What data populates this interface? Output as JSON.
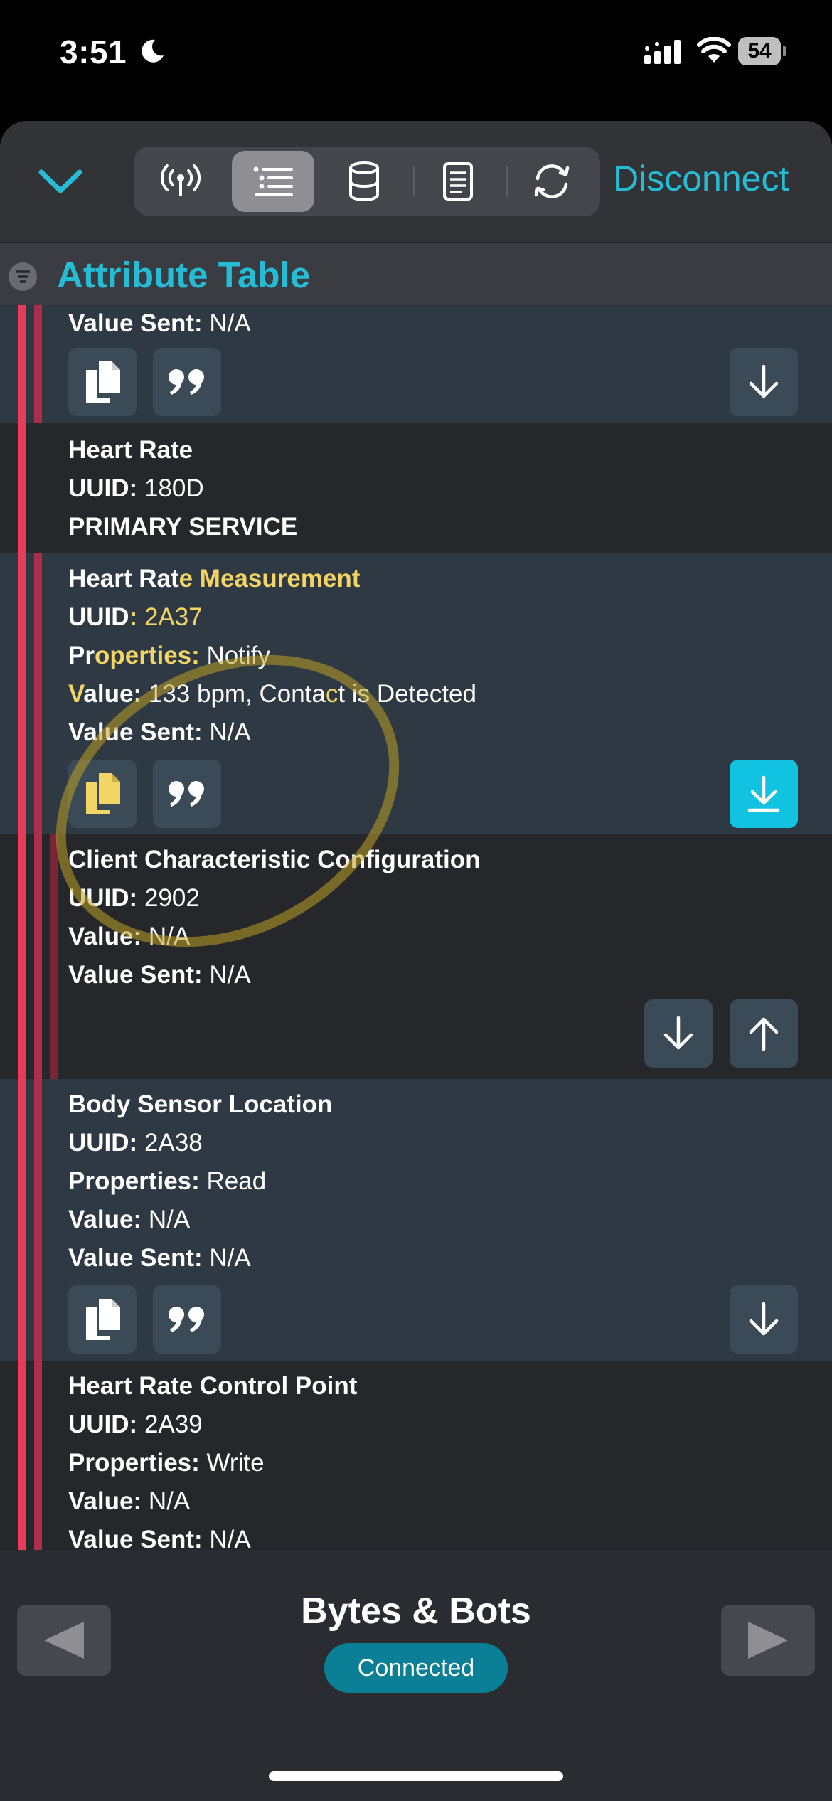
{
  "status": {
    "time": "3:51",
    "battery": "54"
  },
  "toolbar": {
    "tabs": [
      "antenna-icon",
      "list-icon",
      "database-icon",
      "document-icon",
      "sync-icon"
    ],
    "disconnect_label": "Disconnect"
  },
  "header": {
    "title": "Attribute Table"
  },
  "records": {
    "r0": {
      "value_sent_label": "Value Sent:",
      "value_sent": "N/A"
    },
    "r1": {
      "name": "Heart Rate",
      "uuid_label": "UUID:",
      "uuid": "180D",
      "type": "PRIMARY SERVICE"
    },
    "r2": {
      "name_a": "Heart Rat",
      "name_b": "e Measurement",
      "uuid_label_a": "UUID",
      "uuid_label_b": ":",
      "uuid": "2A37",
      "props_label_a": "Pr",
      "props_label_b": "operties:",
      "props_value": "Notify",
      "value_label_a": "V",
      "value_label_b": "alue:",
      "value_a": "133 bpm, Conta",
      "value_b": "c",
      "value_c": "t is Detected",
      "value_sent_label": "Value Sent:",
      "value_sent": "N/A"
    },
    "r3": {
      "name": "Client Characteristic Configuration",
      "uuid_label": "UUID:",
      "uuid": "2902",
      "value_label": "Value:",
      "value": "N/A",
      "value_sent_label": "Value Sent:",
      "value_sent": "N/A"
    },
    "r4": {
      "name": "Body Sensor Location",
      "uuid_label": "UUID:",
      "uuid": "2A38",
      "props_label": "Properties:",
      "props_value": "Read",
      "value_label": "Value:",
      "value": "N/A",
      "value_sent_label": "Value Sent:",
      "value_sent": "N/A"
    },
    "r5": {
      "name": "Heart Rate Control Point",
      "uuid_label": "UUID:",
      "uuid": "2A39",
      "props_label": "Properties:",
      "props_value": "Write",
      "value_label": "Value:",
      "value": "N/A",
      "value_sent_label": "Value Sent:",
      "value_sent": "N/A"
    }
  },
  "footer": {
    "device_name": "Bytes & Bots",
    "status": "Connected"
  },
  "colors": {
    "accent": "#25bdd6",
    "highlight": "#f3d566",
    "bar": "#e63b59"
  }
}
